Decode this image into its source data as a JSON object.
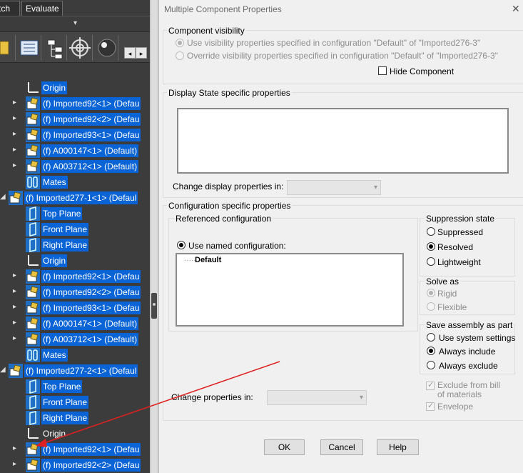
{
  "left_panel": {
    "tabs": [
      "tch",
      "Evaluate"
    ],
    "tree": [
      {
        "label": "Origin",
        "type": "origin",
        "expandable": false
      },
      {
        "label": "(f) Imported92<1> (Defau",
        "type": "part",
        "expandable": true
      },
      {
        "label": "(f) Imported92<2> (Defau",
        "type": "part",
        "expandable": true
      },
      {
        "label": "(f) Imported93<1> (Defau",
        "type": "part",
        "expandable": true
      },
      {
        "label": "(f) A000147<1> (Default)",
        "type": "part",
        "expandable": true
      },
      {
        "label": "(f) A003712<1> (Default)",
        "type": "part",
        "expandable": true
      },
      {
        "label": "Mates",
        "type": "mates",
        "expandable": false
      },
      {
        "label": "(f) Imported277-1<1> (Defaul",
        "type": "assembly",
        "expandable": true
      },
      {
        "label": "Top Plane",
        "type": "plane",
        "expandable": false
      },
      {
        "label": "Front Plane",
        "type": "plane",
        "expandable": false
      },
      {
        "label": "Right Plane",
        "type": "plane",
        "expandable": false
      },
      {
        "label": "Origin",
        "type": "origin",
        "expandable": false
      },
      {
        "label": "(f) Imported92<1> (Defau",
        "type": "part",
        "expandable": true
      },
      {
        "label": "(f) Imported92<2> (Defau",
        "type": "part",
        "expandable": true
      },
      {
        "label": "(f) Imported93<1> (Defau",
        "type": "part",
        "expandable": true
      },
      {
        "label": "(f) A000147<1> (Default)",
        "type": "part",
        "expandable": true
      },
      {
        "label": "(f) A003712<1> (Default)",
        "type": "part",
        "expandable": true
      },
      {
        "label": "Mates",
        "type": "mates",
        "expandable": false
      },
      {
        "label": "(f) Imported277-2<1> (Defaul",
        "type": "assembly",
        "expandable": true
      },
      {
        "label": "Top Plane",
        "type": "plane",
        "expandable": false
      },
      {
        "label": "Front Plane",
        "type": "plane",
        "expandable": false
      },
      {
        "label": "Right Plane",
        "type": "plane",
        "expandable": false
      },
      {
        "label": "Origin",
        "type": "origin",
        "expandable": false
      },
      {
        "label": "(f) Imported92<1> (Defau",
        "type": "part",
        "expandable": true
      },
      {
        "label": "(f) Imported92<2> (Defau",
        "type": "part",
        "expandable": true
      }
    ]
  },
  "dialog": {
    "title": "Multiple Component Properties",
    "visibility": {
      "title": "Component visibility",
      "option1": "Use visibility properties specified in configuration \"Default\" of \"Imported276-3\"",
      "option2": "Override visibility properties specified in configuration \"Default\" of \"Imported276-3\"",
      "hide_label": "Hide Component"
    },
    "display_state": {
      "title": "Display State specific properties",
      "change_label": "Change display properties in:"
    },
    "config": {
      "title": "Configuration specific properties",
      "referenced_title": "Referenced configuration",
      "use_named_label": "Use named configuration:",
      "list_items": [
        "Default"
      ],
      "change_label": "Change properties in:"
    },
    "suppression": {
      "title": "Suppression state",
      "options": [
        "Suppressed",
        "Resolved",
        "Lightweight"
      ],
      "selected": "Resolved"
    },
    "solve_as": {
      "title": "Solve as",
      "options": [
        "Rigid",
        "Flexible"
      ],
      "selected": "Rigid"
    },
    "save_assembly": {
      "title": "Save assembly as part",
      "options": [
        "Use system settings",
        "Always include",
        "Always exclude"
      ],
      "selected": "Always include"
    },
    "exclude_bom_label": "Exclude from bill of materials",
    "envelope_label": "Envelope",
    "buttons": {
      "ok": "OK",
      "cancel": "Cancel",
      "help": "Help"
    }
  },
  "colors": {
    "selection": "#0a64d6",
    "tree_bg": "#3c3c3c",
    "dialog_bg": "#f0f0f0",
    "annotation_arrow": "#e02020"
  }
}
